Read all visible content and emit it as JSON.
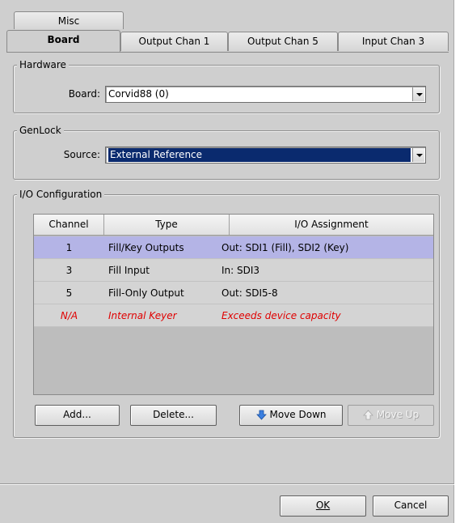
{
  "tabs": {
    "misc": "Misc",
    "board": "Board",
    "output_chan_1": "Output Chan 1",
    "output_chan_5": "Output Chan 5",
    "input_chan_3": "Input Chan 3"
  },
  "hardware": {
    "title": "Hardware",
    "board_label": "Board:",
    "board_value": "Corvid88 (0)"
  },
  "genlock": {
    "title": "GenLock",
    "source_label": "Source:",
    "source_value": "External Reference"
  },
  "io_config": {
    "title": "I/O Configuration",
    "columns": [
      "Channel",
      "Type",
      "I/O Assignment"
    ],
    "rows": [
      {
        "channel": "1",
        "type": "Fill/Key Outputs",
        "assignment": "Out: SDI1 (Fill), SDI2 (Key)",
        "selected": true,
        "error": false
      },
      {
        "channel": "3",
        "type": "Fill Input",
        "assignment": "In: SDI3",
        "selected": false,
        "error": false
      },
      {
        "channel": "5",
        "type": "Fill-Only Output",
        "assignment": "Out: SDI5-8",
        "selected": false,
        "error": false
      },
      {
        "channel": "N/A",
        "type": "Internal Keyer",
        "assignment": "Exceeds device capacity",
        "selected": false,
        "error": true
      }
    ],
    "add_button": "Add...",
    "delete_button": "Delete...",
    "move_down_button": "Move Down",
    "move_up_button": "Move Up"
  },
  "footer": {
    "ok_button": "OK",
    "cancel_button": "Cancel"
  },
  "colors": {
    "selected_row": "#b4b4e6",
    "error_text": "#e00000",
    "selection_highlight": "#0a2a6e"
  },
  "icons": {
    "move_down": "arrow-down-icon",
    "move_up": "arrow-up-icon",
    "combo": "chevron-down-icon"
  }
}
